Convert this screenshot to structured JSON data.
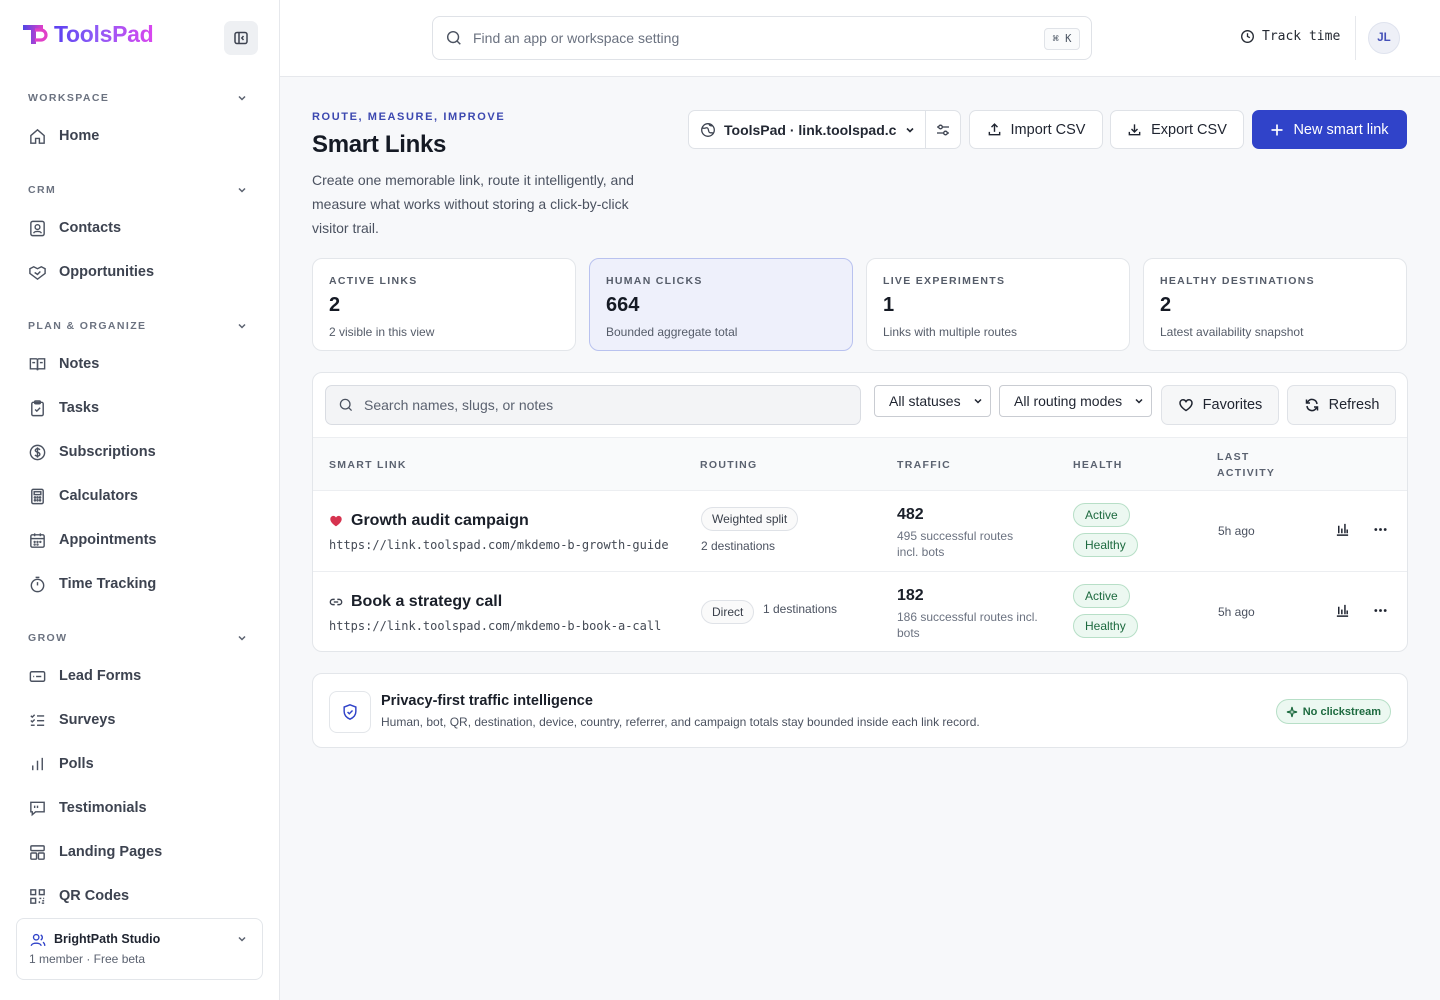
{
  "brand": {
    "name": "ToolsPad"
  },
  "sidebar": {
    "sections": [
      {
        "title": "WORKSPACE",
        "items": [
          {
            "label": "Home",
            "icon": "home-icon"
          }
        ]
      },
      {
        "title": "CRM",
        "items": [
          {
            "label": "Contacts",
            "icon": "contact-card-icon"
          },
          {
            "label": "Opportunities",
            "icon": "handshake-icon"
          }
        ]
      },
      {
        "title": "PLAN & ORGANIZE",
        "items": [
          {
            "label": "Notes",
            "icon": "notebook-icon"
          },
          {
            "label": "Tasks",
            "icon": "clipboard-check-icon"
          },
          {
            "label": "Subscriptions",
            "icon": "dollar-circle-icon"
          },
          {
            "label": "Calculators",
            "icon": "calculator-icon"
          },
          {
            "label": "Appointments",
            "icon": "calendar-icon"
          },
          {
            "label": "Time Tracking",
            "icon": "stopwatch-icon"
          }
        ]
      },
      {
        "title": "GROW",
        "items": [
          {
            "label": "Lead Forms",
            "icon": "form-icon"
          },
          {
            "label": "Surveys",
            "icon": "checklist-icon"
          },
          {
            "label": "Polls",
            "icon": "bar-chart-icon"
          },
          {
            "label": "Testimonials",
            "icon": "quote-bubble-icon"
          },
          {
            "label": "Landing Pages",
            "icon": "layout-icon"
          },
          {
            "label": "QR Codes",
            "icon": "qr-code-icon"
          }
        ]
      }
    ],
    "workspace": {
      "name": "BrightPath Studio",
      "meta": "1 member · Free beta"
    }
  },
  "topbar": {
    "search_placeholder": "Find an app or workspace setting",
    "shortcut": "⌘ K",
    "track_label": "Track time",
    "avatar_initials": "JL"
  },
  "header": {
    "eyebrow": "ROUTE, MEASURE, IMPROVE",
    "title": "Smart Links",
    "description": "Create one memorable link, route it intelligently, and measure what works without storing a click-by-click visitor trail.",
    "domain": "ToolsPad · link.toolspad.c",
    "import_label": "Import CSV",
    "export_label": "Export CSV",
    "new_label": "New smart link"
  },
  "stats": [
    {
      "key": "ACTIVE LINKS",
      "value": "2",
      "sub": "2 visible in this view"
    },
    {
      "key": "HUMAN CLICKS",
      "value": "664",
      "sub": "Bounded aggregate total"
    },
    {
      "key": "LIVE EXPERIMENTS",
      "value": "1",
      "sub": "Links with multiple routes"
    },
    {
      "key": "HEALTHY DESTINATIONS",
      "value": "2",
      "sub": "Latest availability snapshot"
    }
  ],
  "filters": {
    "search_placeholder": "Search names, slugs, or notes",
    "status": "All statuses",
    "routing": "All routing modes",
    "favorites_label": "Favorites",
    "refresh_label": "Refresh"
  },
  "table": {
    "headers": {
      "link": "SMART LINK",
      "routing": "ROUTING",
      "traffic": "TRAFFIC",
      "health": "HEALTH",
      "activity_1": "LAST",
      "activity_2": "ACTIVITY"
    },
    "rows": [
      {
        "name": "Growth audit campaign",
        "icon": "heart-icon",
        "url": "https://link.toolspad.com/mkdemo-b-growth-guide",
        "routing": "Weighted split",
        "destinations": "2 destinations",
        "traffic": "482",
        "traffic_sub": "495 successful routes incl. bots",
        "status": "Active",
        "health": "Healthy",
        "activity": "5h ago"
      },
      {
        "name": "Book a strategy call",
        "icon": "link-icon",
        "url": "https://link.toolspad.com/mkdemo-b-book-a-call",
        "routing": "Direct",
        "destinations": "1 destinations",
        "traffic": "182",
        "traffic_sub": "186 successful routes incl. bots",
        "status": "Active",
        "health": "Healthy",
        "activity": "5h ago"
      }
    ]
  },
  "privacy": {
    "title": "Privacy-first traffic intelligence",
    "description": "Human, bot, QR, destination, device, country, referrer, and campaign totals stay bounded inside each link record.",
    "tag": "No clickstream"
  },
  "colors": {
    "accent": "#3043c9",
    "success": "#1d6a3f",
    "heart": "#d6334f"
  }
}
